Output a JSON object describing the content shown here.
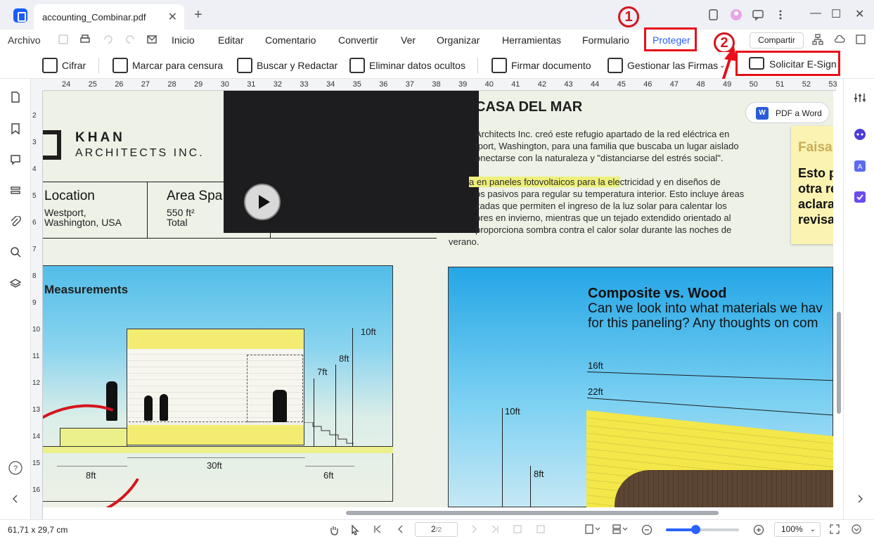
{
  "titlebar": {
    "tab_title": "accounting_Combinar.pdf",
    "close": "✕",
    "add": "+",
    "minimize": "—",
    "maximize": "☐",
    "close_window": "✕"
  },
  "menu": {
    "archivo": "Archivo",
    "items": [
      "Inicio",
      "Editar",
      "Comentario",
      "Convertir",
      "Ver",
      "Organizar",
      "Herramientas",
      "Formulario"
    ],
    "protect": "Proteger",
    "share": "Compartir"
  },
  "toolbar": {
    "encrypt": "Cifrar",
    "mark_redact": "Marcar para censura",
    "search_redact": "Buscar y Redactar",
    "remove_hidden": "Eliminar datos ocultos",
    "sign_doc": "Firmar documento",
    "manage_signatures": "Gestionar las Firmas",
    "request_esign": "Solicitar E-Sign"
  },
  "annotations": {
    "step1": "1",
    "step2": "2"
  },
  "ruler": {
    "h_ticks": [
      "24",
      "25",
      "26",
      "27",
      "28",
      "29",
      "30",
      "31",
      "32",
      "33",
      "34",
      "35",
      "36",
      "37",
      "38",
      "39",
      "40",
      "41",
      "42",
      "43",
      "44",
      "45",
      "46",
      "47",
      "48",
      "49",
      "50",
      "51",
      "52",
      "53"
    ],
    "v_ticks": [
      "2",
      "3",
      "4",
      "5",
      "6",
      "7",
      "8",
      "9",
      "10",
      "11",
      "12",
      "13",
      "14",
      "15",
      "16"
    ]
  },
  "document": {
    "logo_name": "KHAN",
    "logo_sub": "ARCHITECTS INC.",
    "location_label": "Location",
    "location_value_1": "Westport,",
    "location_value_2": "Washington, USA",
    "area_label": "Area Spa",
    "area_value_1": "550 ft²",
    "area_value_2": "Total",
    "article_title": "CASA DEL MAR",
    "para1": [
      "Architects Inc. creó este refugio apartado de la red eléctrica en",
      "tport, Washington, para una familia que buscaba un lugar aislado",
      "onectarse con la naturaleza y \"distanciarse del estrés social\"."
    ],
    "para2_highlight": "a en paneles fotovoltaicos para la ele",
    "para2_first_rest": "ctricidad y en diseños de",
    "para2": [
      "os pasivos para regular su temperatura interior. Esto incluye áreas",
      "zadas que permiten el ingreso de la luz solar para calentar los",
      "ores en invierno, mientras que un tejado extendido orientado al",
      "proporciona sombra contra el calor solar durante las noches de",
      "verano."
    ],
    "pdf_to_word": "PDF a Word",
    "word_icon": "W",
    "sticky_title": "Faisa",
    "sticky_lines": [
      "Esto p",
      "otra re",
      "aclara",
      "revisar"
    ],
    "measurements_title": "Measurements",
    "dims": {
      "d10": "10ft",
      "d8": "8ft",
      "d7": "7ft",
      "d30": "30ft",
      "d8b": "8ft",
      "d6": "6ft"
    },
    "composite_title": "Composite vs. Wood",
    "composite_q1": "Can we look into what materials we hav",
    "composite_q2": "for this paneling? Any thoughts on com",
    "comp_dims": {
      "d16": "16ft",
      "d22": "22ft",
      "d10": "10ft",
      "d8": "8ft"
    }
  },
  "status": {
    "dimensions": "61,71 x 29,7 cm",
    "page_current": "2",
    "page_total": "/2",
    "zoom": "100%",
    "zoom_fraction": 0.4
  },
  "colors": {
    "accent": "#2a62ff",
    "highlight_red": "#e8101c"
  },
  "icons": [
    "app-logo-icon",
    "hand-icon",
    "select-icon",
    "first-page-icon",
    "prev-page-icon",
    "next-page-icon",
    "last-page-icon",
    "zoom-out-icon",
    "zoom-in-icon",
    "fit-icon",
    "help-icon"
  ]
}
